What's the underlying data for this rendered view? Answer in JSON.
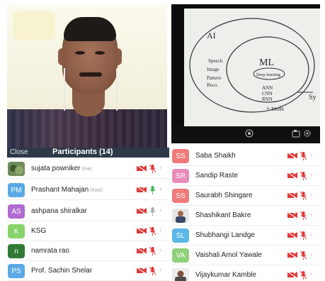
{
  "left_panel": {
    "close_label": "Close",
    "title": "Participants (14)",
    "participants": [
      {
        "name": "sujata powniker",
        "tag": "(me)",
        "initials": "",
        "avatar_color": "#5a7a4a",
        "photo": true,
        "mic": "muted"
      },
      {
        "name": "Prashant Mahajan",
        "tag": "(host)",
        "initials": "PM",
        "avatar_color": "#5aa9e6",
        "photo": false,
        "mic": "active"
      },
      {
        "name": "ashpana shiralkar",
        "tag": "",
        "initials": "AS",
        "avatar_color": "#b06ad0",
        "photo": false,
        "mic": "idle"
      },
      {
        "name": "KSG",
        "tag": "",
        "initials": "K",
        "avatar_color": "#86d36a",
        "photo": false,
        "mic": "muted"
      },
      {
        "name": "namrata rao",
        "tag": "",
        "initials": "n",
        "avatar_color": "#2f7a34",
        "photo": false,
        "mic": "muted"
      },
      {
        "name": "Prof. Sachin Shelar",
        "tag": "",
        "initials": "PS",
        "avatar_color": "#5aa9e6",
        "photo": false,
        "mic": "muted"
      }
    ]
  },
  "right_panel": {
    "participants": [
      {
        "name": "Saba Shaikh",
        "initials": "SS",
        "avatar_color": "#f07a7a",
        "photo": false,
        "mic": "muted"
      },
      {
        "name": "Sandip Raste",
        "initials": "SR",
        "avatar_color": "#e98bb8",
        "photo": false,
        "mic": "muted"
      },
      {
        "name": "Saurabh Shingare",
        "initials": "SS",
        "avatar_color": "#f07a7a",
        "photo": false,
        "mic": "muted"
      },
      {
        "name": "Shashikant Bakre",
        "initials": "",
        "avatar_color": "#d0d0d0",
        "photo": true,
        "mic": "muted"
      },
      {
        "name": "Shubhangi Landge",
        "initials": "SL",
        "avatar_color": "#5ab7e6",
        "photo": false,
        "mic": "muted"
      },
      {
        "name": "Vaishali Amol Yawale",
        "initials": "VA",
        "avatar_color": "#8fd07a",
        "photo": false,
        "mic": "muted"
      },
      {
        "name": "Vijaykumar Kamble",
        "initials": "",
        "avatar_color": "#d0d0d0",
        "photo": true,
        "mic": "muted"
      }
    ]
  },
  "whiteboard": {
    "ai": "AI",
    "ml": "ML",
    "deep_learning": "Deep learning",
    "left_notes": [
      "Speech",
      "Image",
      "Pattern",
      "Reco."
    ],
    "right_notes": [
      "ANN",
      "CNN",
      "RNN"
    ],
    "tools": "+ tools",
    "edge_text": "Sy"
  },
  "icons": {
    "camera_off": "video-off-icon",
    "mic_muted": "mic-muted-icon",
    "mic_active": "mic-active-icon",
    "chevron": "chevron-right-icon"
  },
  "colors": {
    "header_bg": "#2e3947",
    "muted_red": "#e03a3a",
    "active_green": "#3bb54a"
  }
}
